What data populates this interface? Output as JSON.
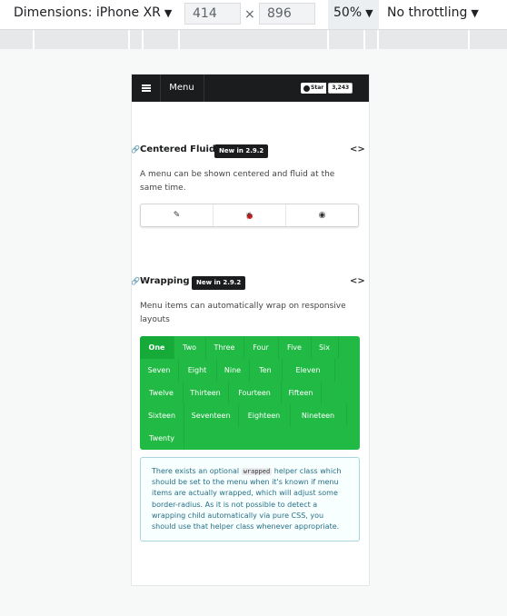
{
  "devtools": {
    "device_label": "Dimensions: iPhone XR",
    "width_value": "414",
    "times": "×",
    "height_value": "896",
    "zoom_label": "50%",
    "throttle_label": "No throttling",
    "caret": "▼"
  },
  "navbar": {
    "menu_label": "Menu",
    "star_label": "Star",
    "star_count": "3,243"
  },
  "sections": {
    "centered": {
      "title": "Centered Fluid",
      "badge": "New in 2.9.2",
      "description": "A menu can be shown centered and fluid at the same time.",
      "code_icon": "<>",
      "anchor": "🔗"
    },
    "wrapping": {
      "title": "Wrapping",
      "badge": "New in 2.9.2",
      "description": "Menu items can automatically wrap on responsive layouts",
      "code_icon": "<>",
      "anchor": "🔗"
    }
  },
  "icon_menu": [
    {
      "icon": "edit-icon",
      "glyph": "✎"
    },
    {
      "icon": "bug-icon",
      "glyph": "🐞"
    },
    {
      "icon": "github-icon",
      "glyph": "◉"
    }
  ],
  "wrap_menu": {
    "items": [
      "One",
      "Two",
      "Three",
      "Four",
      "Five",
      "Six",
      "Seven",
      "Eight",
      "Nine",
      "Ten",
      "Eleven",
      "Twelve",
      "Thirteen",
      "Fourteen",
      "Fifteen",
      "Sixteen",
      "Seventeen",
      "Eighteen",
      "Nineteen",
      "Twenty"
    ],
    "active": "One",
    "color": "#21ba45"
  },
  "info": {
    "before": "There exists an optional ",
    "code": "wrapped",
    "after": " helper class which should be set to the menu when it's known if menu items are actually wrapped, which will adjust some border-radius. As it is not possible to detect a wrapping child automatically via pure CSS, you should use that helper class whenever appropriate."
  }
}
